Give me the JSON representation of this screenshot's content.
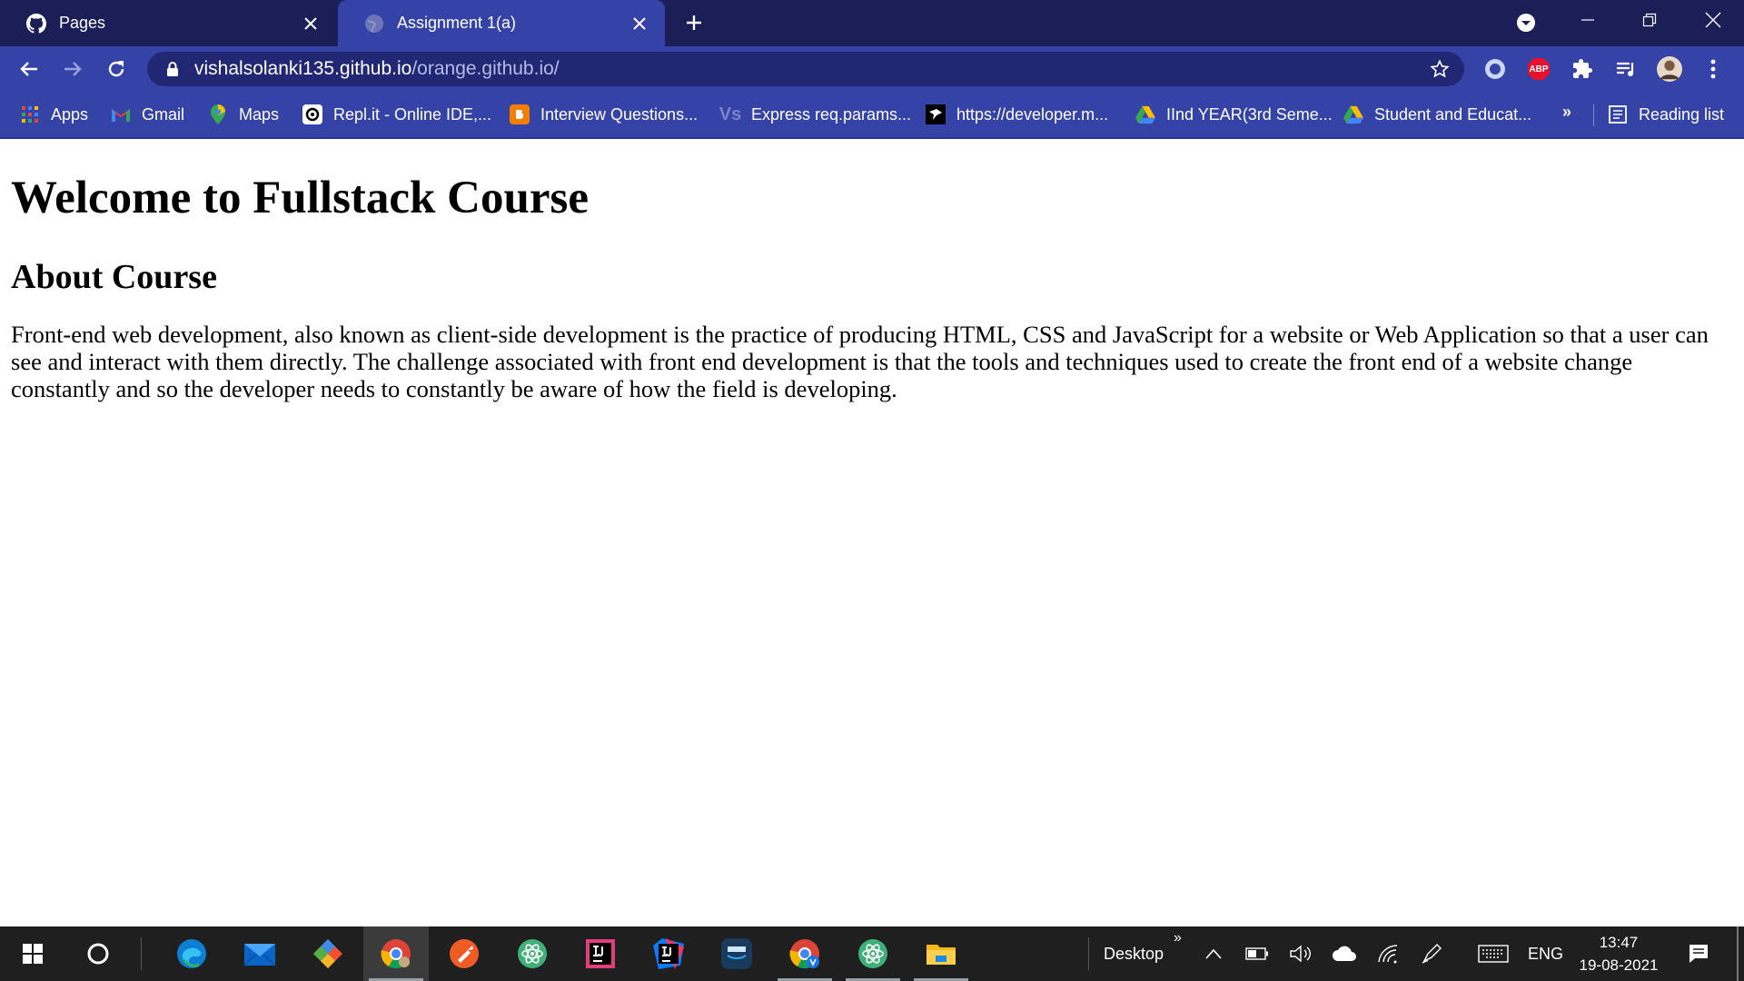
{
  "browser": {
    "tabs": [
      {
        "label": "Pages",
        "icon": "github-icon",
        "active": false
      },
      {
        "label": "Assignment 1(a)",
        "icon": "globe-icon",
        "active": true
      }
    ],
    "address": {
      "host": "vishalsolanki135.github.io",
      "path": "/orange.github.io/"
    },
    "bookmarks": [
      {
        "label": "Apps",
        "icon": "apps-grid-icon"
      },
      {
        "label": "Gmail",
        "icon": "gmail-icon"
      },
      {
        "label": "Maps",
        "icon": "maps-pin-icon"
      },
      {
        "label": "Repl.it - Online IDE,...",
        "icon": "replit-icon"
      },
      {
        "label": "Interview Questions...",
        "icon": "blogger-icon"
      },
      {
        "label": "Express req.params...",
        "icon": "vs-icon"
      },
      {
        "label": "https://developer.m...",
        "icon": "mdn-icon"
      },
      {
        "label": "IInd YEAR(3rd Seme...",
        "icon": "drive-icon"
      },
      {
        "label": "Student and Educat...",
        "icon": "drive-icon"
      }
    ],
    "bookmarks_overflow": "»",
    "reading_list": "Reading list",
    "extensions": {
      "abp_label": "ABP"
    }
  },
  "page": {
    "heading": "Welcome to Fullstack Course",
    "subheading": "About Course",
    "paragraph": "Front-end web development, also known as client-side development is the practice of producing HTML, CSS and JavaScript for a website or Web Application so that a user can see and interact with them directly. The challenge associated with front end development is that the tools and techniques used to create the front end of a website change constantly and so the developer needs to constantly be aware of how the field is developing."
  },
  "taskbar": {
    "desktop_label": "Desktop",
    "desktop_chevron": "»",
    "language": "ENG",
    "time": "13:47",
    "date": "19-08-2021"
  },
  "colors": {
    "tab_strip": "#1b1e57",
    "toolbar": "#3542a6",
    "omnibox": "#222774",
    "taskbar": "#1f1f1f"
  }
}
